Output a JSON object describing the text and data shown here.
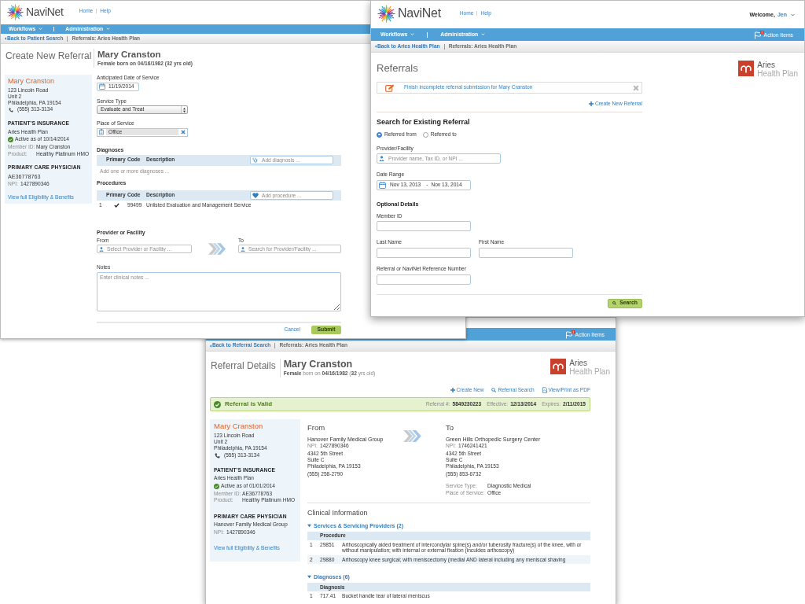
{
  "create_window": {
    "header": {
      "logo": "NaviNet",
      "links": [
        "Home",
        "Help"
      ]
    },
    "nav": {
      "menus": [
        "Workflows",
        "Administration"
      ]
    },
    "breadcrumb": {
      "back": "Back to Patient Search",
      "current": "Referrals: Aries Health Plan"
    },
    "title": "Create New Referral",
    "patient": {
      "name": "Mary Cranston",
      "subtitle": "Female born on 04/16/1982 (32 yrs old)"
    },
    "sidebar": {
      "name": "Mary Cranston",
      "address": [
        "123 Lincoln Road",
        "Unit 2",
        "Philadelphia, PA 19154"
      ],
      "phone": "(555) 313-3134",
      "insurance_heading": "PATIENT'S INSURANCE",
      "plan": "Aries Health Plan",
      "status": "Active as of 10/14/2014",
      "active": true,
      "details": [
        {
          "label": "Member ID:",
          "value": "Mary Cranston"
        },
        {
          "label": "Product:",
          "value": "Healthy Platinum HMO"
        }
      ],
      "pcp_heading": "PRIMARY CARE PHYSICIAN",
      "pcp_name": "AE36778763",
      "pcp_npi": {
        "label": "NPI:",
        "value": "1427890346"
      },
      "link": "View full Eligibility & Benefits"
    },
    "form": {
      "date_of_service": {
        "label": "Anticipated Date of Service",
        "value": "11/19/2014"
      },
      "service_type": {
        "label": "Service Type",
        "value": "Evaluate and Treat"
      },
      "place_of_service": {
        "label": "Place of Service",
        "value": "Office"
      },
      "diagnoses": {
        "heading": "Diagnoses",
        "columns": [
          "Primary",
          "Code",
          "Description"
        ],
        "placeholder": "Add diagnosis ...",
        "empty_text": "Add one or more diagnoses ..."
      },
      "procedures": {
        "heading": "Procedures",
        "columns": [
          "Primary",
          "Code",
          "Description"
        ],
        "placeholder": "Add procedure ...",
        "rows": [
          {
            "number": "1",
            "primary": true,
            "code": "99499",
            "description": "Unlisted Evaluation and Management Service"
          }
        ]
      },
      "provider": {
        "heading": "Provider or Facility",
        "from": {
          "label": "From",
          "placeholder": "Select Provider or Facility ..."
        },
        "to": {
          "label": "To",
          "placeholder": "Search for Provider/Facility ..."
        }
      },
      "notes": {
        "label": "Notes",
        "placeholder": "Enter clinical notes ..."
      },
      "cancel": "Cancel",
      "submit": "Submit"
    }
  },
  "search_window": {
    "header": {
      "logo": "NaviNet",
      "links": [
        "Home",
        "Help"
      ],
      "welcome": "Welcome,",
      "user": "Jen"
    },
    "nav": {
      "menus": [
        "Workflows",
        "Administration"
      ],
      "action_items": "Action Items"
    },
    "breadcrumb": {
      "back": "Back to Aries Health Plan",
      "current": "Referrals: Aries Health Plan"
    },
    "title": "Referrals",
    "plan_logo": {
      "name": "Aries",
      "subtitle": "Health Plan"
    },
    "notice": "Finish incomplete referral submission for Mary Cranston",
    "create_link": "Create New Referral",
    "search": {
      "heading": "Search for Existing Referral",
      "direction": [
        {
          "label": "Referred from",
          "selected": true
        },
        {
          "label": "Referred to",
          "selected": false
        }
      ],
      "provider": {
        "label": "Provider/Facility",
        "placeholder": "Provider name, Tax ID, or NPI ..."
      },
      "date_range": {
        "label": "Date Range",
        "start": "Nov 13, 2013",
        "separator": "-",
        "end": "Nov 13, 2014"
      },
      "optional_heading": "Optional Details",
      "field_rows": [
        [
          {
            "label": "Member ID"
          }
        ],
        [
          {
            "label": "Last Name"
          },
          {
            "label": "First Name"
          }
        ],
        [
          {
            "label": "Referral or NaviNet Reference Number"
          }
        ]
      ],
      "button": "Search"
    }
  },
  "details_window": {
    "nav": {
      "action_items": "Action Items"
    },
    "breadcrumb": {
      "back": "Back to Referral Search",
      "current": "Referrals: Aries Health Plan"
    },
    "title": "Referral Details",
    "patient": {
      "name": "Mary Cranston",
      "subtitle": "**Female** born on **04/16/1982** (**32** yrs old)"
    },
    "plan_logo": {
      "name": "Aries",
      "subtitle": "Health Plan"
    },
    "actions": [
      {
        "kind": "create",
        "label": "Create New"
      },
      {
        "kind": "search",
        "label": "Referral Search"
      },
      {
        "kind": "pdf",
        "label": "View/Print as PDF"
      }
    ],
    "status": {
      "kind": "valid",
      "text": "Referral is Valid",
      "fields": [
        {
          "label": "Referral #:",
          "value": "5849230223"
        },
        {
          "label": "Effective:",
          "value": "12/13/2014"
        },
        {
          "label": "Expires:",
          "value": "2/11/2015"
        }
      ]
    },
    "sidebar": {
      "name": "Mary Cranston",
      "address": [
        "123 Lincoln Road",
        "Unit 2",
        "Philadelphia, PA 19154"
      ],
      "phone": "(555) 313-3134",
      "insurance_heading": "PATIENT'S INSURANCE",
      "plan": "Aries Health Plan",
      "status": "Active as of 01/01/2014",
      "active": true,
      "details": [
        {
          "label": "Member ID:",
          "value": "AE36778763"
        },
        {
          "label": "Product:",
          "value": "Healthy Platinum HMO"
        }
      ],
      "pcp_heading": "PRIMARY CARE PHYSICIAN",
      "pcp_name": "Hanover Family Medical Group",
      "pcp_npi": {
        "label": "NPI:",
        "value": "1427890346"
      },
      "link": "View full Eligibility & Benefits"
    },
    "from": {
      "heading": "From",
      "name": "Hanover Family Medical Group",
      "npi": {
        "label": "NPI:",
        "value": "1427890346"
      },
      "address": [
        "4342 5th Street",
        "Suite C",
        "Philadelphia, PA 19153"
      ],
      "phone": "(555) 258-2790"
    },
    "to": {
      "heading": "To",
      "name": "Green Hills Orthopedic Surgery Center",
      "npi": {
        "label": "NPI:",
        "value": "1746241421"
      },
      "address": [
        "4342 5th Street",
        "Suite C",
        "Philadelphia, PA 19153"
      ],
      "phone": "(555) 853-6732",
      "details": [
        {
          "label": "Service Type:",
          "value": "Diagnostic Medical"
        },
        {
          "label": "Place of Service:",
          "value": "Office"
        }
      ]
    },
    "clinical": {
      "heading": "Clinical Information",
      "sections": [
        {
          "title": "Services & Servicing Providers (2)",
          "expanded": true,
          "column": "Procedure",
          "rows": [
            {
              "number": "1",
              "code": "29851",
              "description": "Arthoscopically aided treatment of intercondylar spine(s) and/or tuberosity fracture(s) of the knee, with or without manipulation; with internal or external fixation (inculdes arthoscopy)"
            },
            {
              "number": "2",
              "code": "29880",
              "description": "Arthoscopy knee surgical; with meniscectomy (medial AND lateral including any meniscal shaving"
            }
          ]
        },
        {
          "title": "Diagnoses (6)",
          "expanded": true,
          "column": "Diagnosis",
          "rows": [
            {
              "number": "1",
              "code": "717.41",
              "description": "Bucket handle tear of lateral meniscus"
            }
          ]
        }
      ]
    }
  }
}
